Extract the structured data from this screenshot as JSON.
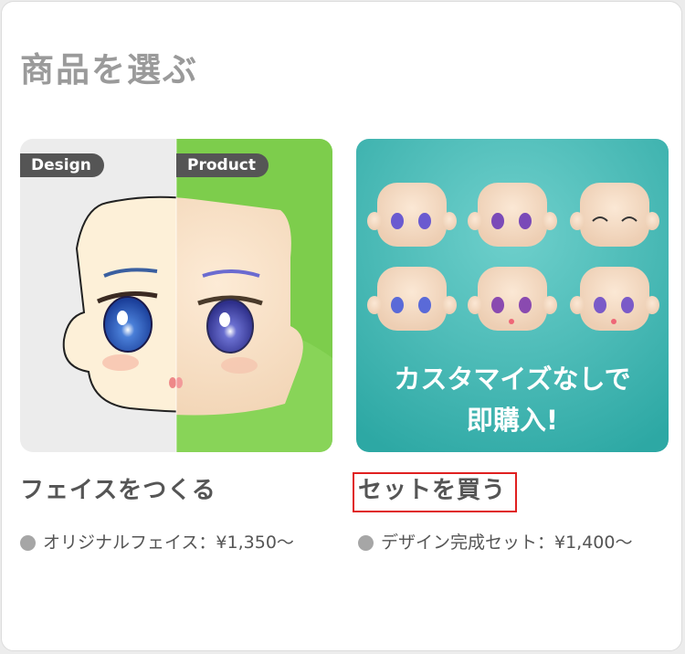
{
  "section_title": "商品を選ぶ",
  "cards": [
    {
      "tags": [
        "Design",
        "Product"
      ],
      "heading": "フェイスをつくる",
      "price_line": "オリジナルフェイス：¥1,350〜"
    },
    {
      "banner_line1": "カスタマイズなしで",
      "banner_line2": "即購入!",
      "heading": "セットを買う",
      "price_line": "デザイン完成セット：¥1,400〜"
    }
  ],
  "colors": {
    "title": "#9a9a9a",
    "heading": "#555555",
    "dot": "#a6a6a6",
    "highlight": "#e02020",
    "green_bg": "#7dcd4c",
    "teal_bg": "#3bb1ad"
  },
  "icons": [
    "bullet-dot-icon"
  ]
}
